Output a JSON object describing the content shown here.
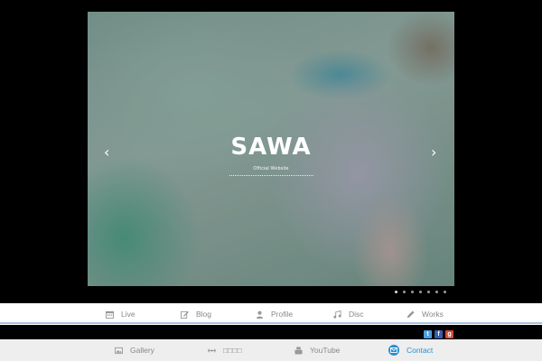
{
  "hero": {
    "title": "SAWA",
    "subtitle": "Official Website",
    "prev_icon": "chevron-left-icon",
    "next_icon": "chevron-right-icon"
  },
  "pager": {
    "count": 7,
    "active": 0
  },
  "main_nav": {
    "items": [
      {
        "label": "Live",
        "icon": "calendar-icon"
      },
      {
        "label": "Blog",
        "icon": "edit-icon"
      },
      {
        "label": "Profile",
        "icon": "user-icon"
      },
      {
        "label": "Disc",
        "icon": "music-icon"
      },
      {
        "label": "Works",
        "icon": "pencil-icon"
      }
    ]
  },
  "social": {
    "items": [
      {
        "label": "t",
        "icon": "twitter-icon",
        "color": "#4b9fe0"
      },
      {
        "label": "f",
        "icon": "facebook-icon",
        "color": "#3b5bab"
      },
      {
        "label": "g",
        "icon": "google-icon",
        "color": "#d44b3a"
      }
    ]
  },
  "sub_nav": {
    "items": [
      {
        "label": "Gallery",
        "icon": "image-icon"
      },
      {
        "label": "□□□□",
        "icon": "link-icon"
      },
      {
        "label": "YouTube",
        "icon": "youtube-icon"
      },
      {
        "label": "Contact",
        "icon": "mail-icon"
      }
    ]
  },
  "colors": {
    "background": "#000000",
    "nav_text": "#888888",
    "contact_accent": "#2a8fd0",
    "nav_divider": "#a9c4e0"
  }
}
